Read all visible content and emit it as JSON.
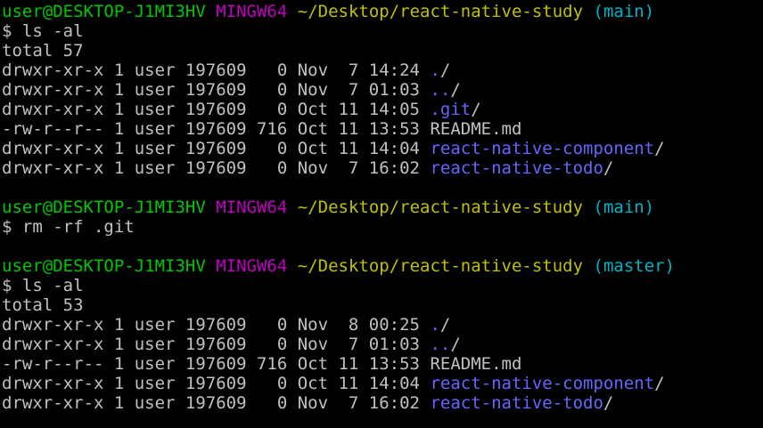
{
  "colors": {
    "background": "#000000",
    "text": "#c0c0c0",
    "user_host": "#00c800",
    "mingw": "#c000c0",
    "path": "#c0c000",
    "branch": "#00b4c8",
    "directory": "#6666ff"
  },
  "lines": [
    {
      "kind": "prompt",
      "user": "user@DESKTOP-J1MI3HV",
      "system": "MINGW64",
      "path": "~/Desktop/react-native-study",
      "branch": "(main)"
    },
    {
      "kind": "command",
      "text": "$ ls -al"
    },
    {
      "kind": "text",
      "text": "total 57"
    },
    {
      "kind": "entry",
      "meta": "drwxr-xr-x 1 user 197609   0 Nov  7 14:24 ",
      "name": ".",
      "is_dir": true
    },
    {
      "kind": "entry",
      "meta": "drwxr-xr-x 1 user 197609   0 Nov  7 01:03 ",
      "name": "..",
      "is_dir": true
    },
    {
      "kind": "entry",
      "meta": "drwxr-xr-x 1 user 197609   0 Oct 11 14:05 ",
      "name": ".git",
      "is_dir": true
    },
    {
      "kind": "entry",
      "meta": "-rw-r--r-- 1 user 197609 716 Oct 11 13:53 ",
      "name": "README.md",
      "is_dir": false
    },
    {
      "kind": "entry",
      "meta": "drwxr-xr-x 1 user 197609   0 Oct 11 14:04 ",
      "name": "react-native-component",
      "is_dir": true
    },
    {
      "kind": "entry",
      "meta": "drwxr-xr-x 1 user 197609   0 Nov  7 16:02 ",
      "name": "react-native-todo",
      "is_dir": true
    },
    {
      "kind": "blank"
    },
    {
      "kind": "prompt",
      "user": "user@DESKTOP-J1MI3HV",
      "system": "MINGW64",
      "path": "~/Desktop/react-native-study",
      "branch": "(main)"
    },
    {
      "kind": "command",
      "text": "$ rm -rf .git"
    },
    {
      "kind": "blank"
    },
    {
      "kind": "prompt",
      "user": "user@DESKTOP-J1MI3HV",
      "system": "MINGW64",
      "path": "~/Desktop/react-native-study",
      "branch": "(master)"
    },
    {
      "kind": "command",
      "text": "$ ls -al"
    },
    {
      "kind": "text",
      "text": "total 53"
    },
    {
      "kind": "entry",
      "meta": "drwxr-xr-x 1 user 197609   0 Nov  8 00:25 ",
      "name": ".",
      "is_dir": true
    },
    {
      "kind": "entry",
      "meta": "drwxr-xr-x 1 user 197609   0 Nov  7 01:03 ",
      "name": "..",
      "is_dir": true
    },
    {
      "kind": "entry",
      "meta": "-rw-r--r-- 1 user 197609 716 Oct 11 13:53 ",
      "name": "README.md",
      "is_dir": false
    },
    {
      "kind": "entry",
      "meta": "drwxr-xr-x 1 user 197609   0 Oct 11 14:04 ",
      "name": "react-native-component",
      "is_dir": true
    },
    {
      "kind": "entry",
      "meta": "drwxr-xr-x 1 user 197609   0 Nov  7 16:02 ",
      "name": "react-native-todo",
      "is_dir": true
    }
  ]
}
